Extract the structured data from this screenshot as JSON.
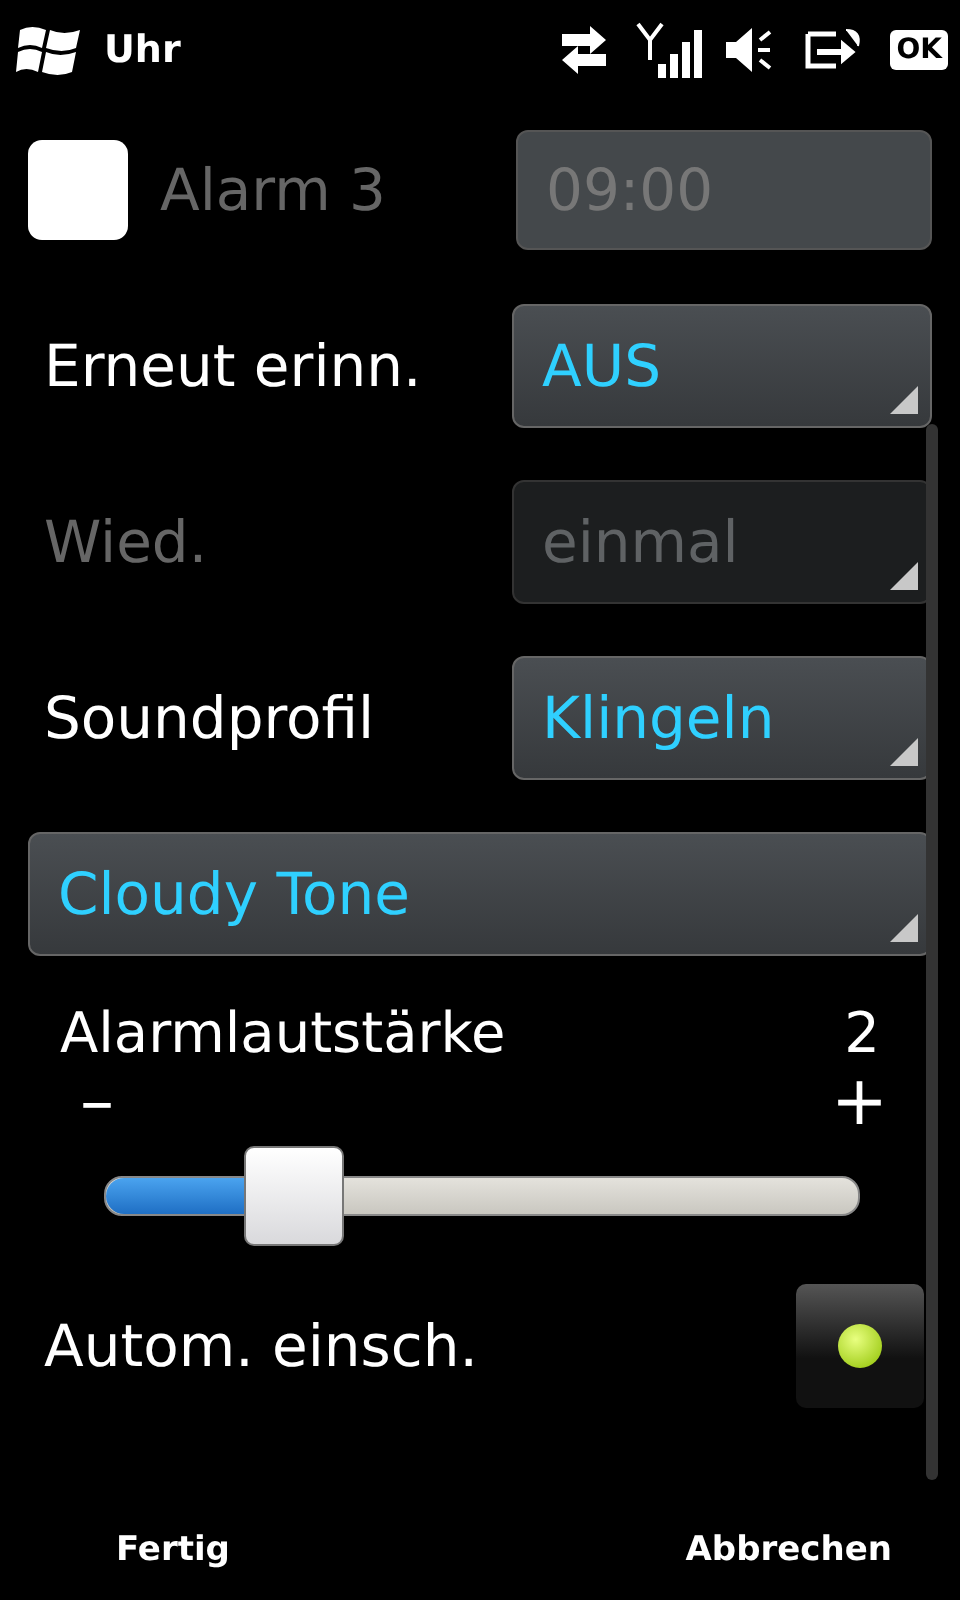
{
  "status_bar": {
    "title": "Uhr",
    "ok_button": "OK"
  },
  "alarm": {
    "checked": false,
    "label": "Alarm 3",
    "enabled": false,
    "time": "09:00"
  },
  "settings": [
    {
      "kind": "select",
      "label": "Erneut erinn.",
      "value": "AUS",
      "disabled": false
    },
    {
      "kind": "select",
      "label": "Wied.",
      "value": "einmal",
      "disabled": true
    },
    {
      "kind": "select",
      "label": "Soundprofil",
      "value": "Klingeln",
      "disabled": false
    }
  ],
  "tone": {
    "value": "Cloudy Tone"
  },
  "volume": {
    "label": "Alarmlautstärke",
    "reading": "2",
    "minus": "–",
    "plus": "+",
    "level": 0.25
  },
  "auto_on": {
    "label": "Autom. einsch.",
    "on": true
  },
  "softkeys": [
    "Fertig",
    "Abbrechen"
  ]
}
